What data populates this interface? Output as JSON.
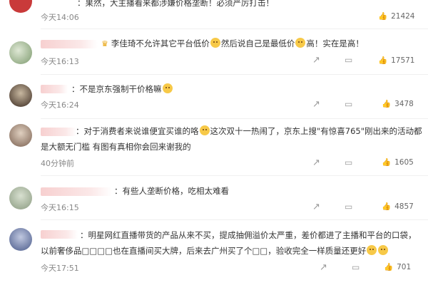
{
  "comments": [
    {
      "text": "：果然，大主播看来都涉嫌价格垄断！必须严厉打击！",
      "time": "今天14:06",
      "likes": "21424",
      "avatar_color": "#c93a3a"
    },
    {
      "text": "李佳琦不允许其它平台低价",
      "text_b": "然后说自己是最低价",
      "text_c": "高！实在是高！",
      "time": "今天16:13",
      "likes": "17571",
      "avatar_color": "#7d9a6e"
    },
    {
      "text": "：不是京东强制干价格嘛",
      "time": "今天16:24",
      "likes": "3478",
      "avatar_color": "#5a4a3a"
    },
    {
      "text": "：对于消费者来说谁便宜买谁的咯",
      "text_b": "这次双十一热闹了，京东上搜\"有惊喜765\"刚出来的活动都",
      "line2": "是大额无门槛 有图有真相你会回来谢我的",
      "time": "40分钟前",
      "likes": "1605",
      "avatar_color": "#9a8070"
    },
    {
      "text": "：有些人垄断价格，吃相太难看",
      "time": "今天16:15",
      "likes": "4857",
      "avatar_color": "#8a9a80"
    },
    {
      "text": "：明星网红直播带货的产品从来不买，提成抽佣溢价太严重，差价都进了主播和平台的口袋，",
      "line2": "以前奢侈品□□□□也在直播间买大牌，后来去广州买了个□□，验收完全一样质量还更好",
      "time": "今天17:51",
      "likes": "701",
      "avatar_color": "#4a5a8a"
    }
  ],
  "icons": [
    "share-icon",
    "comment-icon",
    "like-icon"
  ]
}
